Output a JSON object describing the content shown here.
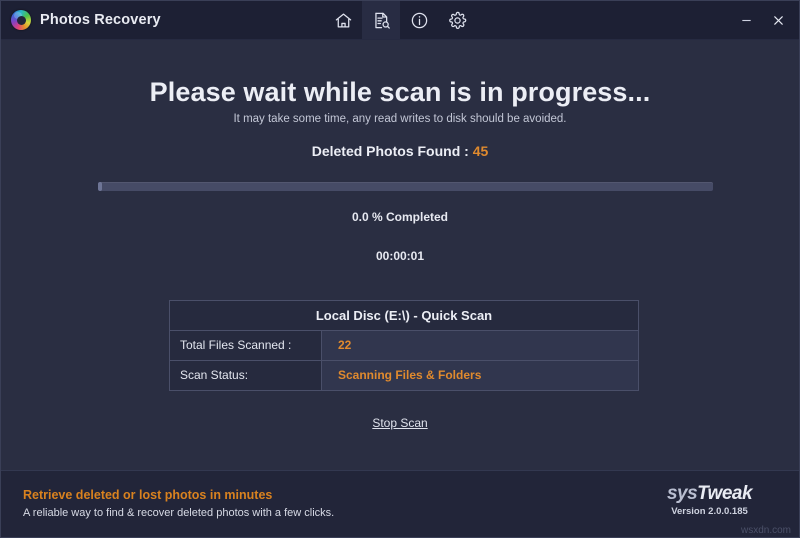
{
  "window": {
    "title": "Photos Recovery",
    "logo_icon": "photos-recovery-logo-icon",
    "minimize_label": "–",
    "close_label": "×"
  },
  "toolbar": {
    "items": [
      {
        "name": "home",
        "icon": "home-icon",
        "active": false
      },
      {
        "name": "scan",
        "icon": "document-search-icon",
        "active": true
      },
      {
        "name": "info",
        "icon": "info-circle-icon",
        "active": false
      },
      {
        "name": "settings",
        "icon": "gear-icon",
        "active": false
      }
    ]
  },
  "main": {
    "headline": "Please wait while scan is in progress...",
    "subheadline": "It may take some time, any read writes to disk should be avoided.",
    "found_label": "Deleted Photos Found :",
    "found_count": "45",
    "progress_percent": 0.0,
    "percent_text": "0.0 % Completed",
    "elapsed_time": "00:00:01",
    "stop_scan_label": "Stop Scan"
  },
  "scan_table": {
    "header": "Local Disc (E:\\) - Quick Scan",
    "rows": [
      {
        "label": "Total Files Scanned :",
        "value": "22"
      },
      {
        "label": "Scan Status:",
        "value": "Scanning Files & Folders"
      }
    ]
  },
  "footer": {
    "tagline": "Retrieve deleted or lost photos in minutes",
    "subtext": "A reliable way to find & recover deleted photos with a few clicks.",
    "brand_sys": "sys",
    "brand_tweak": "Tweak",
    "version": "Version 2.0.0.185",
    "watermark": "wsxdn.com"
  },
  "colors": {
    "background": "#2a2e42",
    "titlebar": "#1d2034",
    "accent_orange": "#e08a2e",
    "footer_orange": "#d9821f",
    "text_primary": "#eceef5"
  }
}
